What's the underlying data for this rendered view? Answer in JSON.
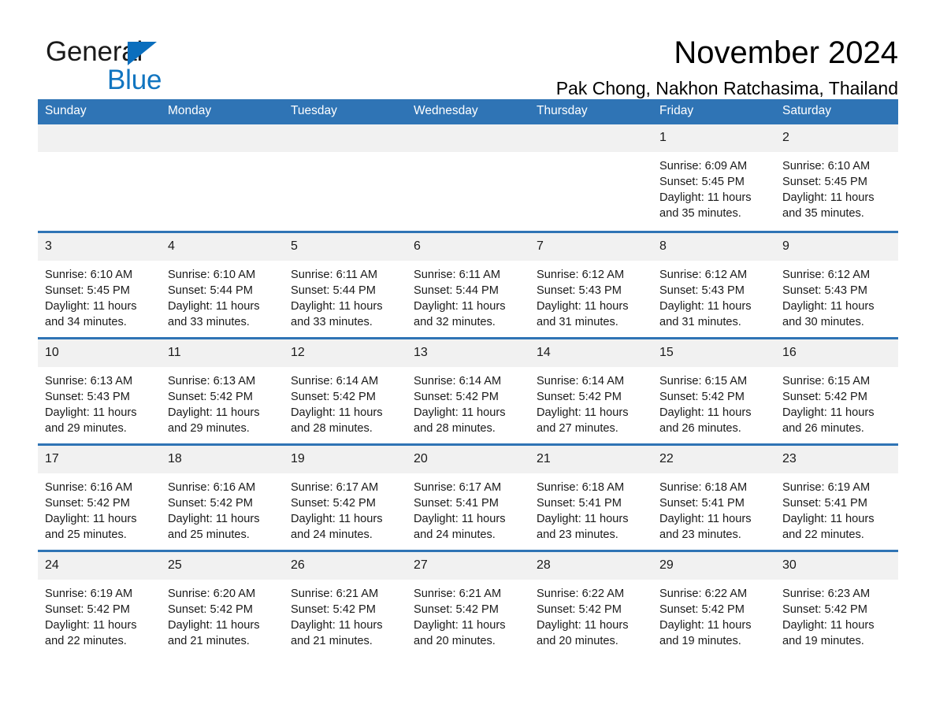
{
  "brand": {
    "name_part1": "General",
    "name_part2": "Blue",
    "triangle_color": "#0a6ebd",
    "blue_text_color": "#1175c0"
  },
  "header": {
    "month_title": "November 2024",
    "location": "Pak Chong, Nakhon Ratchasima, Thailand"
  },
  "theme": {
    "header_blue": "#2f74b5",
    "daynum_gray": "#f1f1f1",
    "row_border": "#2f74b5"
  },
  "calendar": {
    "weekday_headers": [
      "Sunday",
      "Monday",
      "Tuesday",
      "Wednesday",
      "Thursday",
      "Friday",
      "Saturday"
    ],
    "weeks": [
      [
        {
          "day": "",
          "lines": []
        },
        {
          "day": "",
          "lines": []
        },
        {
          "day": "",
          "lines": []
        },
        {
          "day": "",
          "lines": []
        },
        {
          "day": "",
          "lines": []
        },
        {
          "day": "1",
          "lines": [
            "Sunrise: 6:09 AM",
            "Sunset: 5:45 PM",
            "Daylight: 11 hours and 35 minutes."
          ]
        },
        {
          "day": "2",
          "lines": [
            "Sunrise: 6:10 AM",
            "Sunset: 5:45 PM",
            "Daylight: 11 hours and 35 minutes."
          ]
        }
      ],
      [
        {
          "day": "3",
          "lines": [
            "Sunrise: 6:10 AM",
            "Sunset: 5:45 PM",
            "Daylight: 11 hours and 34 minutes."
          ]
        },
        {
          "day": "4",
          "lines": [
            "Sunrise: 6:10 AM",
            "Sunset: 5:44 PM",
            "Daylight: 11 hours and 33 minutes."
          ]
        },
        {
          "day": "5",
          "lines": [
            "Sunrise: 6:11 AM",
            "Sunset: 5:44 PM",
            "Daylight: 11 hours and 33 minutes."
          ]
        },
        {
          "day": "6",
          "lines": [
            "Sunrise: 6:11 AM",
            "Sunset: 5:44 PM",
            "Daylight: 11 hours and 32 minutes."
          ]
        },
        {
          "day": "7",
          "lines": [
            "Sunrise: 6:12 AM",
            "Sunset: 5:43 PM",
            "Daylight: 11 hours and 31 minutes."
          ]
        },
        {
          "day": "8",
          "lines": [
            "Sunrise: 6:12 AM",
            "Sunset: 5:43 PM",
            "Daylight: 11 hours and 31 minutes."
          ]
        },
        {
          "day": "9",
          "lines": [
            "Sunrise: 6:12 AM",
            "Sunset: 5:43 PM",
            "Daylight: 11 hours and 30 minutes."
          ]
        }
      ],
      [
        {
          "day": "10",
          "lines": [
            "Sunrise: 6:13 AM",
            "Sunset: 5:43 PM",
            "Daylight: 11 hours and 29 minutes."
          ]
        },
        {
          "day": "11",
          "lines": [
            "Sunrise: 6:13 AM",
            "Sunset: 5:42 PM",
            "Daylight: 11 hours and 29 minutes."
          ]
        },
        {
          "day": "12",
          "lines": [
            "Sunrise: 6:14 AM",
            "Sunset: 5:42 PM",
            "Daylight: 11 hours and 28 minutes."
          ]
        },
        {
          "day": "13",
          "lines": [
            "Sunrise: 6:14 AM",
            "Sunset: 5:42 PM",
            "Daylight: 11 hours and 28 minutes."
          ]
        },
        {
          "day": "14",
          "lines": [
            "Sunrise: 6:14 AM",
            "Sunset: 5:42 PM",
            "Daylight: 11 hours and 27 minutes."
          ]
        },
        {
          "day": "15",
          "lines": [
            "Sunrise: 6:15 AM",
            "Sunset: 5:42 PM",
            "Daylight: 11 hours and 26 minutes."
          ]
        },
        {
          "day": "16",
          "lines": [
            "Sunrise: 6:15 AM",
            "Sunset: 5:42 PM",
            "Daylight: 11 hours and 26 minutes."
          ]
        }
      ],
      [
        {
          "day": "17",
          "lines": [
            "Sunrise: 6:16 AM",
            "Sunset: 5:42 PM",
            "Daylight: 11 hours and 25 minutes."
          ]
        },
        {
          "day": "18",
          "lines": [
            "Sunrise: 6:16 AM",
            "Sunset: 5:42 PM",
            "Daylight: 11 hours and 25 minutes."
          ]
        },
        {
          "day": "19",
          "lines": [
            "Sunrise: 6:17 AM",
            "Sunset: 5:42 PM",
            "Daylight: 11 hours and 24 minutes."
          ]
        },
        {
          "day": "20",
          "lines": [
            "Sunrise: 6:17 AM",
            "Sunset: 5:41 PM",
            "Daylight: 11 hours and 24 minutes."
          ]
        },
        {
          "day": "21",
          "lines": [
            "Sunrise: 6:18 AM",
            "Sunset: 5:41 PM",
            "Daylight: 11 hours and 23 minutes."
          ]
        },
        {
          "day": "22",
          "lines": [
            "Sunrise: 6:18 AM",
            "Sunset: 5:41 PM",
            "Daylight: 11 hours and 23 minutes."
          ]
        },
        {
          "day": "23",
          "lines": [
            "Sunrise: 6:19 AM",
            "Sunset: 5:41 PM",
            "Daylight: 11 hours and 22 minutes."
          ]
        }
      ],
      [
        {
          "day": "24",
          "lines": [
            "Sunrise: 6:19 AM",
            "Sunset: 5:42 PM",
            "Daylight: 11 hours and 22 minutes."
          ]
        },
        {
          "day": "25",
          "lines": [
            "Sunrise: 6:20 AM",
            "Sunset: 5:42 PM",
            "Daylight: 11 hours and 21 minutes."
          ]
        },
        {
          "day": "26",
          "lines": [
            "Sunrise: 6:21 AM",
            "Sunset: 5:42 PM",
            "Daylight: 11 hours and 21 minutes."
          ]
        },
        {
          "day": "27",
          "lines": [
            "Sunrise: 6:21 AM",
            "Sunset: 5:42 PM",
            "Daylight: 11 hours and 20 minutes."
          ]
        },
        {
          "day": "28",
          "lines": [
            "Sunrise: 6:22 AM",
            "Sunset: 5:42 PM",
            "Daylight: 11 hours and 20 minutes."
          ]
        },
        {
          "day": "29",
          "lines": [
            "Sunrise: 6:22 AM",
            "Sunset: 5:42 PM",
            "Daylight: 11 hours and 19 minutes."
          ]
        },
        {
          "day": "30",
          "lines": [
            "Sunrise: 6:23 AM",
            "Sunset: 5:42 PM",
            "Daylight: 11 hours and 19 minutes."
          ]
        }
      ]
    ]
  }
}
